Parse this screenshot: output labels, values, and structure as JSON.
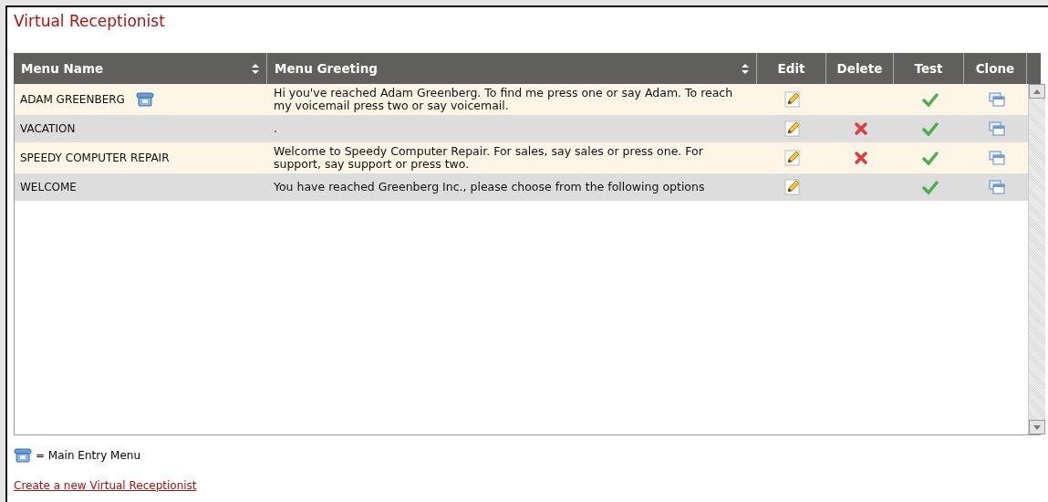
{
  "title": "Virtual Receptionist",
  "table": {
    "columns": [
      {
        "label": "Menu Name",
        "sortable": true
      },
      {
        "label": "Menu Greeting",
        "sortable": true
      },
      {
        "label": "Edit",
        "sortable": false
      },
      {
        "label": "Delete",
        "sortable": false
      },
      {
        "label": "Test",
        "sortable": false
      },
      {
        "label": "Clone",
        "sortable": false
      }
    ],
    "rows": [
      {
        "name": "ADAM GREENBERG",
        "main_entry": true,
        "greeting": "Hi you've reached Adam Greenberg. To find me press one or say Adam. To reach my voicemail press two or say voicemail.",
        "deletable": false
      },
      {
        "name": "VACATION",
        "main_entry": false,
        "greeting": ".",
        "deletable": true
      },
      {
        "name": "SPEEDY COMPUTER REPAIR",
        "main_entry": false,
        "greeting": "Welcome to Speedy Computer Repair. For sales, say sales or press one. For support, say support or press two.",
        "deletable": true
      },
      {
        "name": "WELCOME",
        "main_entry": false,
        "greeting": "You have reached Greenberg Inc., please choose from the following options",
        "deletable": false
      }
    ]
  },
  "legend": "= Main Entry Menu",
  "create_link": "Create a new Virtual Receptionist"
}
